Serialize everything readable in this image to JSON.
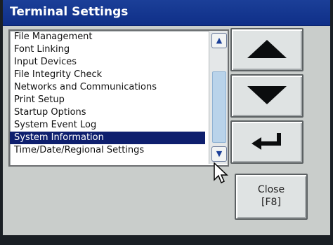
{
  "window": {
    "title": "Terminal Settings"
  },
  "list": {
    "items": [
      "File Management",
      "Font Linking",
      "Input Devices",
      "File Integrity Check",
      "Networks and Communications",
      "Print Setup",
      "Startup Options",
      "System Event Log",
      "System Information",
      "Time/Date/Regional Settings"
    ],
    "selected_index": 8
  },
  "buttons": {
    "close_label": "Close",
    "close_key": "[F8]",
    "up_icon": "triangle-up-icon",
    "down_icon": "triangle-down-icon",
    "enter_icon": "enter-return-icon"
  },
  "colors": {
    "title_bar": "#1b3f98",
    "selection": "#0e1f6e",
    "panel": "#c9cdcb"
  }
}
